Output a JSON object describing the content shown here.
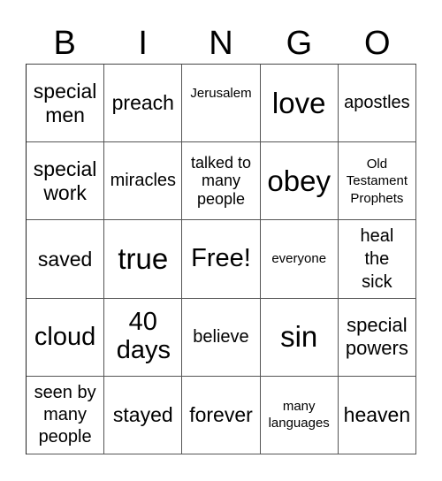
{
  "header": {
    "letters": [
      "B",
      "I",
      "N",
      "G",
      "O"
    ]
  },
  "card": {
    "rows": [
      [
        "special men",
        "preach",
        "Jerusalem",
        "love",
        "apostles"
      ],
      [
        "special work",
        "miracles",
        "talked to many people",
        "obey",
        "Old Testament Prophets"
      ],
      [
        "saved",
        "true",
        "Free!",
        "everyone",
        "heal the sick"
      ],
      [
        "cloud",
        "40 days",
        "believe",
        "sin",
        "special powers"
      ],
      [
        "seen by many people",
        "stayed",
        "forever",
        "many languages",
        "heaven"
      ]
    ]
  }
}
